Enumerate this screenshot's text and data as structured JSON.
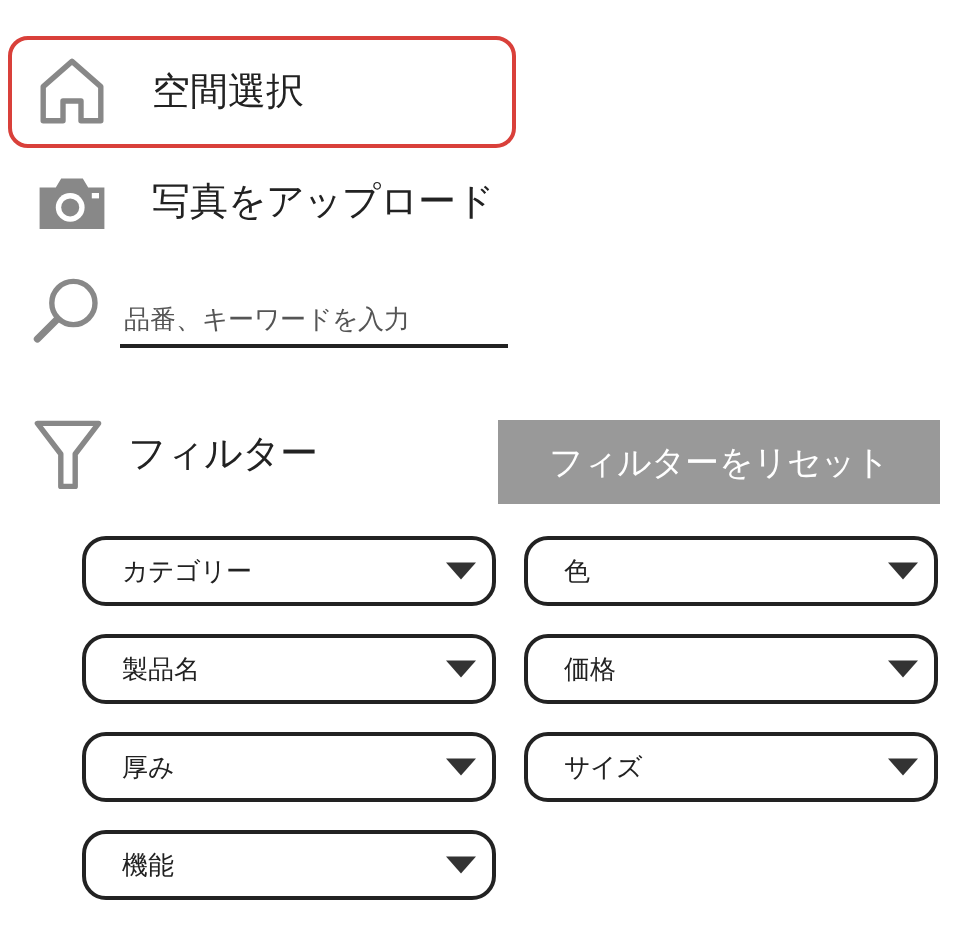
{
  "nav": [
    {
      "label": "空間選択",
      "selected": true
    },
    {
      "label": "写真をアップロード",
      "selected": false
    }
  ],
  "search": {
    "placeholder": "品番、キーワードを入力"
  },
  "filter": {
    "label": "フィルター",
    "reset_button": "フィルターをリセット"
  },
  "dropdowns": [
    {
      "label": "カテゴリー"
    },
    {
      "label": "色"
    },
    {
      "label": "製品名"
    },
    {
      "label": "価格"
    },
    {
      "label": "厚み"
    },
    {
      "label": "サイズ"
    },
    {
      "label": "機能"
    }
  ]
}
